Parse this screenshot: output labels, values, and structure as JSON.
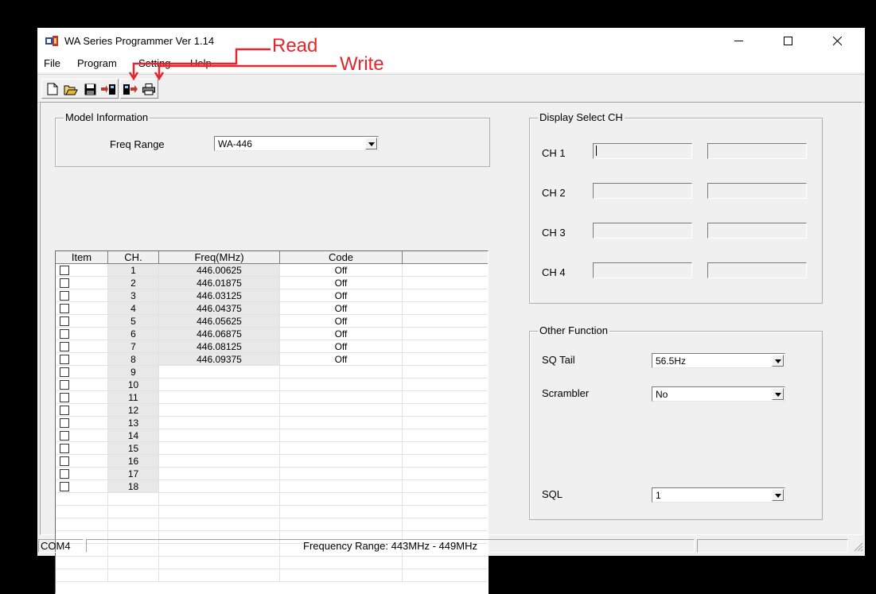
{
  "window": {
    "title": "WA Series Programmer Ver 1.14"
  },
  "menu": [
    "File",
    "Program",
    "Setting",
    "Help"
  ],
  "toolbar": [
    "new-icon",
    "open-icon",
    "save-icon",
    "read-radio-icon",
    "write-radio-icon",
    "print-icon"
  ],
  "annotations": {
    "read": "Read",
    "write": "Write",
    "color": "#e8252a"
  },
  "model_info": {
    "title": "Model Information",
    "freq_range_label": "Freq Range",
    "freq_range_value": "WA-446"
  },
  "table": {
    "headers": [
      "Item",
      "CH.",
      "Freq(MHz)",
      "Code"
    ],
    "rows": [
      {
        "ch": "1",
        "freq": "446.00625",
        "code": "Off"
      },
      {
        "ch": "2",
        "freq": "446.01875",
        "code": "Off"
      },
      {
        "ch": "3",
        "freq": "446.03125",
        "code": "Off"
      },
      {
        "ch": "4",
        "freq": "446.04375",
        "code": "Off"
      },
      {
        "ch": "5",
        "freq": "446.05625",
        "code": "Off"
      },
      {
        "ch": "6",
        "freq": "446.06875",
        "code": "Off"
      },
      {
        "ch": "7",
        "freq": "446.08125",
        "code": "Off"
      },
      {
        "ch": "8",
        "freq": "446.09375",
        "code": "Off"
      },
      {
        "ch": "9",
        "freq": "",
        "code": ""
      },
      {
        "ch": "10",
        "freq": "",
        "code": ""
      },
      {
        "ch": "11",
        "freq": "",
        "code": ""
      },
      {
        "ch": "12",
        "freq": "",
        "code": ""
      },
      {
        "ch": "13",
        "freq": "",
        "code": ""
      },
      {
        "ch": "14",
        "freq": "",
        "code": ""
      },
      {
        "ch": "15",
        "freq": "",
        "code": ""
      },
      {
        "ch": "16",
        "freq": "",
        "code": ""
      },
      {
        "ch": "17",
        "freq": "",
        "code": ""
      },
      {
        "ch": "18",
        "freq": "",
        "code": ""
      }
    ]
  },
  "display_select": {
    "title": "Display Select CH",
    "channels": [
      "CH 1",
      "CH 2",
      "CH 3",
      "CH 4"
    ]
  },
  "other_function": {
    "title": "Other Function",
    "sq_tail_label": "SQ Tail",
    "sq_tail_value": "56.5Hz",
    "scrambler_label": "Scrambler",
    "scrambler_value": "No",
    "sql_label": "SQL",
    "sql_value": "1"
  },
  "status": {
    "port": "COM4",
    "range": "Frequency Range: 443MHz - 449MHz"
  }
}
